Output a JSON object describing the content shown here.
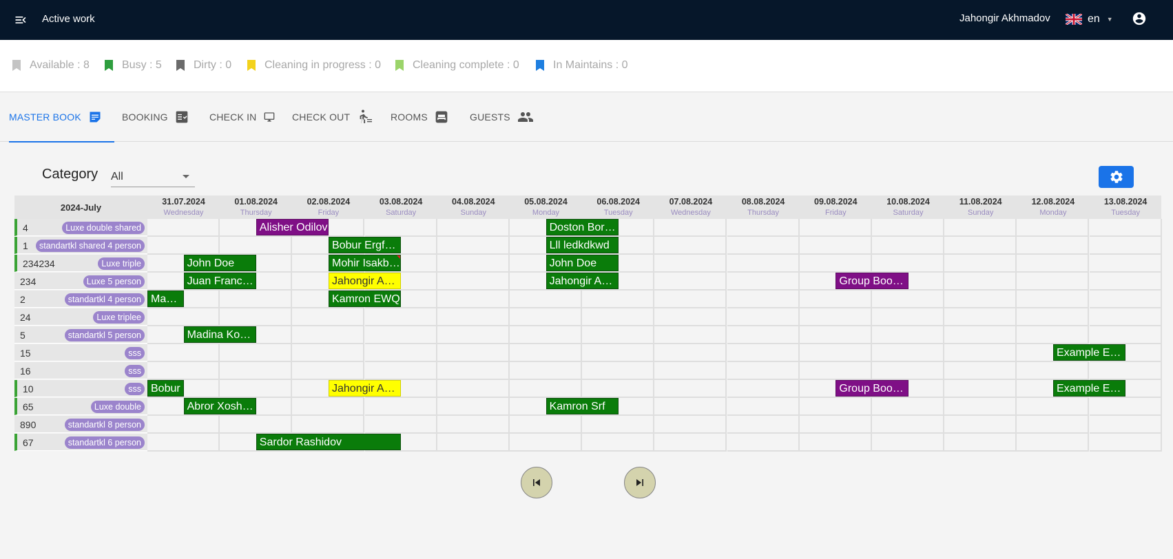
{
  "header": {
    "title": "Active work",
    "user_name": "Jahongir Akhmadov",
    "language": "en"
  },
  "status": [
    {
      "label": "Available : 8",
      "color": "#c4c4c4"
    },
    {
      "label": "Busy : 5",
      "color": "#2e9e3e"
    },
    {
      "label": "Dirty : 0",
      "color": "#6b6b6b"
    },
    {
      "label": "Cleaning in progress : 0",
      "color": "#f3d21c"
    },
    {
      "label": "Cleaning complete : 0",
      "color": "#9bd46a"
    },
    {
      "label": "In Maintains : 0",
      "color": "#1f7fe0"
    }
  ],
  "tabs": [
    {
      "label": "MASTER BOOK",
      "icon": "master-book-icon",
      "active": true
    },
    {
      "label": "BOOKING",
      "icon": "booking-icon",
      "active": false
    },
    {
      "label": "CHECK IN",
      "icon": "monitor-icon",
      "active": false
    },
    {
      "label": "CHECK OUT",
      "icon": "walking-icon",
      "active": false
    },
    {
      "label": "ROOMS",
      "icon": "bed-icon",
      "active": false
    },
    {
      "label": "GUESTS",
      "icon": "people-icon",
      "active": false
    }
  ],
  "filter": {
    "label": "Category",
    "value": "All"
  },
  "calendar": {
    "month": "2024-July",
    "days": [
      {
        "date": "31.07.2024",
        "weekday": "Wednesday"
      },
      {
        "date": "01.08.2024",
        "weekday": "Thursday"
      },
      {
        "date": "02.08.2024",
        "weekday": "Friday"
      },
      {
        "date": "03.08.2024",
        "weekday": "Saturday"
      },
      {
        "date": "04.08.2024",
        "weekday": "Sunday"
      },
      {
        "date": "05.08.2024",
        "weekday": "Monday"
      },
      {
        "date": "06.08.2024",
        "weekday": "Tuesday"
      },
      {
        "date": "07.08.2024",
        "weekday": "Wednesday"
      },
      {
        "date": "08.08.2024",
        "weekday": "Thursday"
      },
      {
        "date": "09.08.2024",
        "weekday": "Friday"
      },
      {
        "date": "10.08.2024",
        "weekday": "Saturday"
      },
      {
        "date": "11.08.2024",
        "weekday": "Sunday"
      },
      {
        "date": "12.08.2024",
        "weekday": "Monday"
      },
      {
        "date": "13.08.2024",
        "weekday": "Tuesday"
      }
    ],
    "rooms": [
      {
        "number": "4",
        "type": "Luxe double shared",
        "occupied": true
      },
      {
        "number": "1",
        "type": "standartkl shared 4 person",
        "occupied": true
      },
      {
        "number": "234234",
        "type": "Luxe triple",
        "occupied": true
      },
      {
        "number": "234",
        "type": "Luxe 5 person",
        "occupied": false
      },
      {
        "number": "2",
        "type": "standartkl 4 person",
        "occupied": false
      },
      {
        "number": "24",
        "type": "Luxe triplee",
        "occupied": false
      },
      {
        "number": "5",
        "type": "standartkl 5 person",
        "occupied": false
      },
      {
        "number": "15",
        "type": "sss",
        "occupied": false
      },
      {
        "number": "16",
        "type": "sss",
        "occupied": false
      },
      {
        "number": "10",
        "type": "sss",
        "occupied": true
      },
      {
        "number": "65",
        "type": "Luxe double",
        "occupied": true
      },
      {
        "number": "890",
        "type": "standartkl 8 person",
        "occupied": false
      },
      {
        "number": "67",
        "type": "standartkl 6 person",
        "occupied": true
      }
    ],
    "bookings": [
      {
        "room": 0,
        "start": 1.5,
        "end": 2.5,
        "guest": "Alisher Odilov",
        "color": "purple"
      },
      {
        "room": 0,
        "start": 5.5,
        "end": 6.5,
        "guest": "Doston Boriev",
        "color": "green"
      },
      {
        "room": 1,
        "start": 2.5,
        "end": 3.5,
        "guest": "Bobur Ergfenov",
        "color": "green"
      },
      {
        "room": 1,
        "start": 5.5,
        "end": 6.5,
        "guest": "Lll ledkdkwd",
        "color": "green"
      },
      {
        "room": 2,
        "start": 0.5,
        "end": 1.5,
        "guest": "John Doe",
        "color": "green"
      },
      {
        "room": 2,
        "start": 2.5,
        "end": 3.5,
        "guest": "Mohir Isakbekov",
        "color": "green",
        "flag": true
      },
      {
        "room": 2,
        "start": 5.5,
        "end": 6.5,
        "guest": "John Doe",
        "color": "green"
      },
      {
        "room": 3,
        "start": 0.5,
        "end": 1.5,
        "guest": "Juan Francisco",
        "color": "green"
      },
      {
        "room": 3,
        "start": 2.5,
        "end": 3.5,
        "guest": "Jahongir Akhmadov",
        "color": "yellow"
      },
      {
        "room": 3,
        "start": 5.5,
        "end": 6.5,
        "guest": "Jahongir Akhmadov",
        "color": "green"
      },
      {
        "room": 3,
        "start": 9.5,
        "end": 10.5,
        "guest": "Group Booking",
        "color": "purple"
      },
      {
        "room": 4,
        "start": 0,
        "end": 0.5,
        "guest": "Madina",
        "color": "green"
      },
      {
        "room": 4,
        "start": 2.5,
        "end": 3.5,
        "guest": "Kamron EWQ",
        "color": "green"
      },
      {
        "room": 6,
        "start": 0.5,
        "end": 1.5,
        "guest": "Madina Komilova",
        "color": "green"
      },
      {
        "room": 7,
        "start": 12.5,
        "end": 13.5,
        "guest": "Example Example",
        "color": "green"
      },
      {
        "room": 9,
        "start": 0,
        "end": 0.5,
        "guest": "Bobur",
        "color": "green"
      },
      {
        "room": 9,
        "start": 2.5,
        "end": 3.5,
        "guest": "Jahongir Akhmadov",
        "color": "yellow"
      },
      {
        "room": 9,
        "start": 9.5,
        "end": 10.5,
        "guest": "Group Booking",
        "color": "purple"
      },
      {
        "room": 9,
        "start": 12.5,
        "end": 13.5,
        "guest": "Example Example",
        "color": "green"
      },
      {
        "room": 10,
        "start": 0.5,
        "end": 1.5,
        "guest": "Abror Xoshimov",
        "color": "green"
      },
      {
        "room": 10,
        "start": 5.5,
        "end": 6.5,
        "guest": "Kamron Srf",
        "color": "green"
      },
      {
        "room": 12,
        "start": 1.5,
        "end": 3.5,
        "guest": "Sardor Rashidov",
        "color": "green"
      }
    ]
  }
}
